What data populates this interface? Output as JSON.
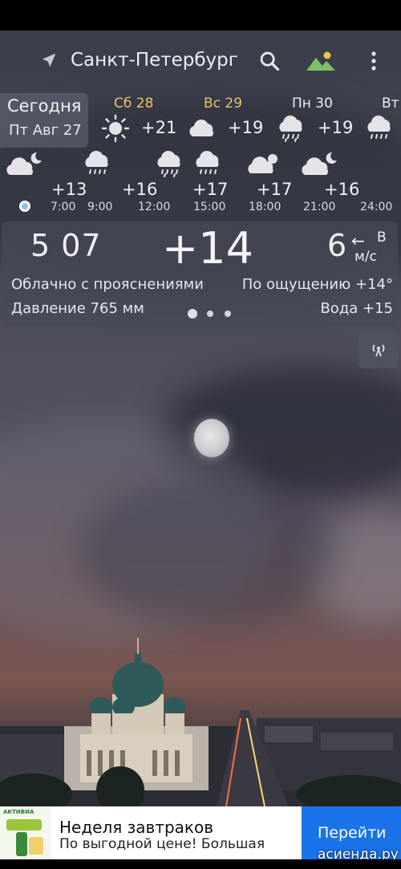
{
  "header": {
    "city": "Санкт-Петербург",
    "icons": [
      "location-arrow-icon",
      "search-icon",
      "landscape-icon",
      "more-vert-icon"
    ]
  },
  "today": {
    "label": "Сегодня",
    "date": "Пт Авг 27"
  },
  "days": [
    {
      "name": "Сб 28",
      "icon": "sun-icon",
      "temp": "+21",
      "color": "#e9c46a"
    },
    {
      "name": "Вс 29",
      "icon": "cloud-icon",
      "temp": "+19",
      "color": "#e9c46a"
    },
    {
      "name": "Пн 30",
      "icon": "rain-cloud-icon",
      "temp": "+19",
      "color": "#eeeeee"
    },
    {
      "name": "Вт",
      "icon": "rain-cloud-icon",
      "temp": "",
      "color": "#eeeeee"
    }
  ],
  "hourly": [
    {
      "time": "7:00",
      "temp": "+13",
      "icon": "partly-cloudy-night-icon"
    },
    {
      "time": "9:00",
      "temp": "",
      "icon": "rain-cloud-icon"
    },
    {
      "time": "12:00",
      "temp": "+16",
      "icon": ""
    },
    {
      "time": "15:00",
      "temp": "+17",
      "icon": "rain-cloud-icon"
    },
    {
      "time": "18:00",
      "temp": "+17",
      "icon": "partly-cloudy-icon"
    },
    {
      "time": "21:00",
      "temp": "+16",
      "icon": "partly-cloudy-night-icon"
    },
    {
      "time": "24:00",
      "temp": "",
      "icon": ""
    }
  ],
  "current": {
    "time": "5 07",
    "temp": "+14",
    "wind_speed": "6",
    "wind_arrow": "←",
    "wind_dir": "В",
    "wind_unit": "м/с",
    "condition": "Облачно с прояснениями",
    "feels_like": "По ощущению +14°",
    "pressure": "Давление 765 мм",
    "water": "Вода +15"
  },
  "ad": {
    "title": "Неделя завтраков",
    "subtitle": "По выгодной цене! Большая",
    "button": "Перейти",
    "brand": "АКТИВИА",
    "button_color": "#1a73e8"
  },
  "watermark": "асиенда.ру",
  "colors": {
    "weekend": "#e9c46a",
    "now_dot": "#8fc0e8"
  }
}
